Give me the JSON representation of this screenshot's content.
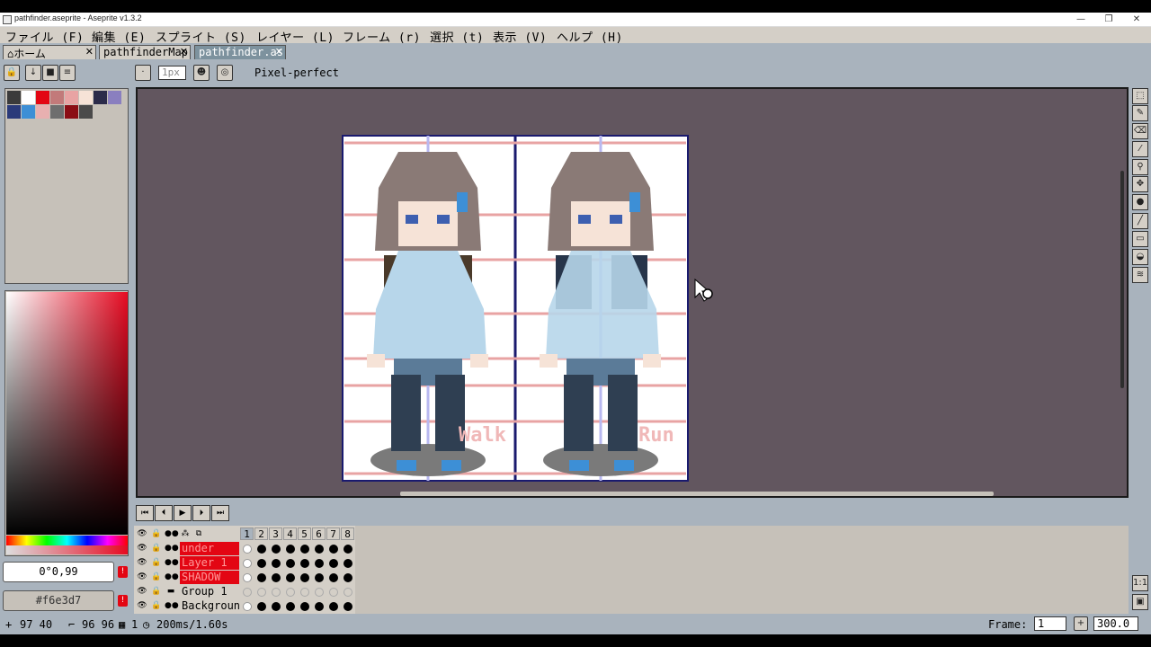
{
  "window": {
    "title": "pathfinder.aseprite - Aseprite v1.3.2"
  },
  "menu": [
    "ファイル (F)",
    "編集 (E)",
    "スプライト (S)",
    "レイヤー (L)",
    "フレーム (r)",
    "選択 (t)",
    "表示 (V)",
    "ヘルプ (H)"
  ],
  "tabs": [
    {
      "label": "ホーム",
      "active": false
    },
    {
      "label": "pathfinderMap",
      "active": false
    },
    {
      "label": "pathfinder.as",
      "active": true
    }
  ],
  "toolbar": {
    "brush_size": "1px",
    "pixel_perfect": "Pixel-perfect"
  },
  "palette": {
    "colors": [
      "#3b3b3b",
      "#ffffff",
      "#e30613",
      "#c27a7a",
      "#e8a3a3",
      "#f6e3d7",
      "#2b2b4a",
      "#8a7fbf",
      "#2a3a7a",
      "#3d8fd6",
      "#e8b0b0",
      "#6e6e6e",
      "#8b0d14",
      "#4a4a4a"
    ]
  },
  "color": {
    "hsv_value": "0°0,99",
    "hex_value": "#f6e3d7",
    "accent": "#e30613"
  },
  "canvas": {
    "background": "#62565f",
    "frame_labels": [
      "Walk",
      "Run"
    ]
  },
  "timeline": {
    "frames": [
      "1",
      "2",
      "3",
      "4",
      "5",
      "6",
      "7",
      "8"
    ],
    "current_frame": "1",
    "layers": [
      {
        "name": "under",
        "highlight": true
      },
      {
        "name": "Layer 1",
        "highlight": true
      },
      {
        "name": "SHADOW",
        "highlight": true
      },
      {
        "name": "Group 1",
        "highlight": false
      },
      {
        "name": "Background",
        "highlight": false
      }
    ]
  },
  "status": {
    "position": "97 40",
    "size": "96 96",
    "frame_info": "1",
    "duration": "200ms/1.60s",
    "frame_label": "Frame:",
    "frame_value": "1",
    "zoom": "300.0"
  }
}
